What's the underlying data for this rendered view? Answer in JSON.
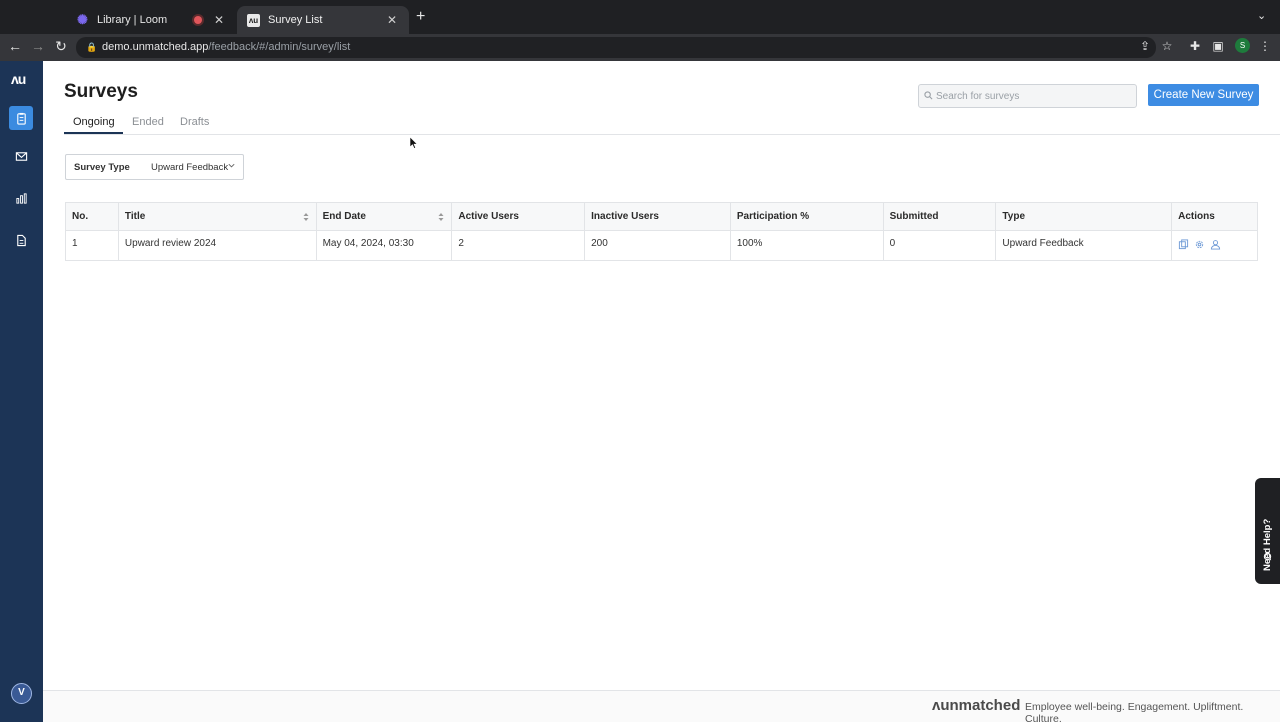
{
  "browser": {
    "tabs": [
      {
        "title": "Library | Loom",
        "favicon": "loom-icon"
      },
      {
        "title": "Survey List",
        "favicon": "au-icon"
      }
    ],
    "url_domain": "demo.unmatched.app",
    "url_path": "/feedback/#/admin/survey/list",
    "profile_initial": "S"
  },
  "sidebar": {
    "logo": "ᴧu",
    "items": [
      {
        "name": "surveys",
        "icon": "clipboard-icon",
        "active": true
      },
      {
        "name": "mail",
        "icon": "mail-icon",
        "active": false
      },
      {
        "name": "analytics",
        "icon": "bar-chart-icon",
        "active": false
      },
      {
        "name": "reports",
        "icon": "document-icon",
        "active": false
      }
    ],
    "avatar_initial": "V"
  },
  "header": {
    "title": "Surveys",
    "search_placeholder": "Search for surveys",
    "create_button": "Create New Survey"
  },
  "tabs": [
    {
      "label": "Ongoing",
      "active": true
    },
    {
      "label": "Ended",
      "active": false
    },
    {
      "label": "Drafts",
      "active": false
    }
  ],
  "filter": {
    "label": "Survey Type",
    "value": "Upward Feedback"
  },
  "table": {
    "columns": [
      "No.",
      "Title",
      "End Date",
      "Active Users",
      "Inactive Users",
      "Participation %",
      "Submitted",
      "Type",
      "Actions"
    ],
    "rows": [
      {
        "no": "1",
        "title": "Upward review 2024",
        "end_date": "May 04, 2024, 03:30",
        "active_users": "2",
        "inactive_users": "200",
        "participation": "100%",
        "submitted": "0",
        "type": "Upward Feedback"
      }
    ]
  },
  "help": {
    "label": "Need Help?"
  },
  "footer": {
    "brand": "ᴧunmatched",
    "tagline": "Employee well-being. Engagement. Upliftment. Culture."
  },
  "colors": {
    "sidebar": "#1c3456",
    "accent": "#3d8ce3",
    "chrome": "#35363a"
  }
}
